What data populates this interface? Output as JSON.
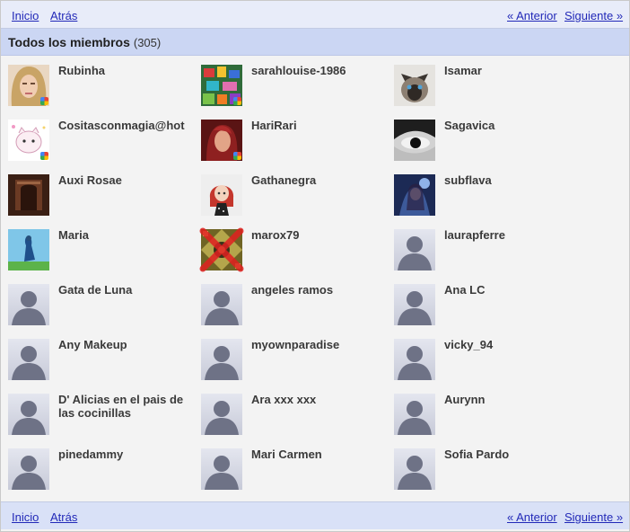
{
  "nav": {
    "home": "Inicio",
    "back": "Atrás",
    "prev": "« Anterior",
    "next": "Siguiente »"
  },
  "header": {
    "title": "Todos los miembros",
    "count": "(305)"
  },
  "members": [
    {
      "name": "Rubinha",
      "avatar": "photo-woman-blonde",
      "badge": true
    },
    {
      "name": "sarahlouise-1986",
      "avatar": "photo-colorful-collage",
      "badge": true
    },
    {
      "name": "Isamar",
      "avatar": "photo-siamese-cat",
      "badge": false
    },
    {
      "name": "Cositasconmagia@hot",
      "avatar": "photo-cartoon-cat",
      "badge": true
    },
    {
      "name": "HariRari",
      "avatar": "photo-red-portrait",
      "badge": true
    },
    {
      "name": "Sagavica",
      "avatar": "photo-dark-eye",
      "badge": false
    },
    {
      "name": "Auxi Rosae",
      "avatar": "photo-dark-vintage",
      "badge": false
    },
    {
      "name": "Gathanegra",
      "avatar": "photo-cartoon-girl",
      "badge": false
    },
    {
      "name": "subflava",
      "avatar": "photo-blue-fantasy",
      "badge": false
    },
    {
      "name": "Maria",
      "avatar": "photo-blue-sky-figure",
      "badge": false
    },
    {
      "name": "marox79",
      "avatar": "photo-gold-pattern",
      "badge": false,
      "crossed": true
    },
    {
      "name": "laurapferre",
      "avatar": "default-silhouette",
      "badge": false
    },
    {
      "name": "Gata de Luna",
      "avatar": "default-silhouette",
      "badge": false
    },
    {
      "name": "angeles ramos",
      "avatar": "default-silhouette",
      "badge": false
    },
    {
      "name": "Ana LC",
      "avatar": "default-silhouette",
      "badge": false
    },
    {
      "name": "Any Makeup",
      "avatar": "default-silhouette",
      "badge": false
    },
    {
      "name": "myownparadise",
      "avatar": "default-silhouette",
      "badge": false
    },
    {
      "name": "vicky_94",
      "avatar": "default-silhouette",
      "badge": false
    },
    {
      "name": "D' Alicias en el pais de las cocinillas",
      "avatar": "default-silhouette",
      "badge": false
    },
    {
      "name": "Ara xxx xxx",
      "avatar": "default-silhouette",
      "badge": false
    },
    {
      "name": "Aurynn",
      "avatar": "default-silhouette",
      "badge": false
    },
    {
      "name": "pinedammy",
      "avatar": "default-silhouette",
      "badge": false
    },
    {
      "name": "Mari Carmen",
      "avatar": "default-silhouette",
      "badge": false
    },
    {
      "name": "Sofia Pardo",
      "avatar": "default-silhouette",
      "badge": false
    }
  ]
}
